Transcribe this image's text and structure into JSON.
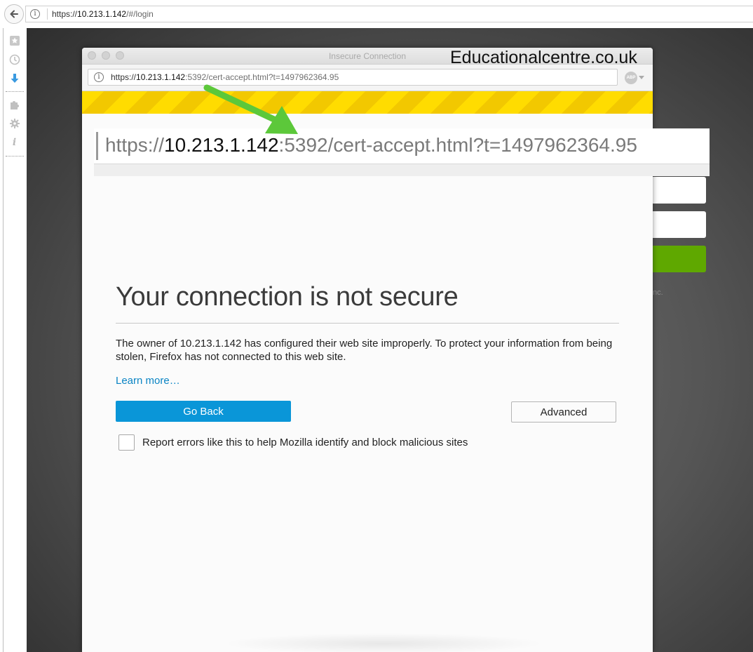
{
  "outer_browser": {
    "url_scheme": "https://",
    "url_host": "10.213.1.142",
    "url_path": "/#/login"
  },
  "sidebar": {
    "icons": [
      "bookmarks-icon",
      "history-icon",
      "downloads-icon",
      "addons-icon",
      "settings-icon",
      "info-icon"
    ]
  },
  "popup": {
    "title": "Insecure Connection",
    "url_scheme": "https://",
    "url_host": "10.213.1.142",
    "url_rest": ":5392/cert-accept.html?t=1497962364.95",
    "addon_badge": "ABP"
  },
  "zoom_url": {
    "scheme": "https://",
    "host": "10.213.1.142",
    "rest": ":5392/cert-accept.html?t=1497962364.95"
  },
  "watermark": "Educationalcentre.co.uk",
  "error_page": {
    "headline": "Your connection is not secure",
    "description": "The owner of 10.213.1.142 has configured their web site improperly. To protect your information from being stolen, Firefox has not connected to this web site.",
    "learn_more": "Learn more…",
    "go_back_label": "Go Back",
    "advanced_label": "Advanced",
    "report_label": "Report errors like this to help Mozilla identify and block malicious sites",
    "report_checked": false
  },
  "background_page": {
    "footer_text": "nc."
  },
  "colors": {
    "accent_blue": "#0a96d8",
    "link_blue": "#0a84c4",
    "warning_yellow": "#ffdc00",
    "login_green": "#5fa800",
    "arrow_green": "#5cc83a"
  }
}
